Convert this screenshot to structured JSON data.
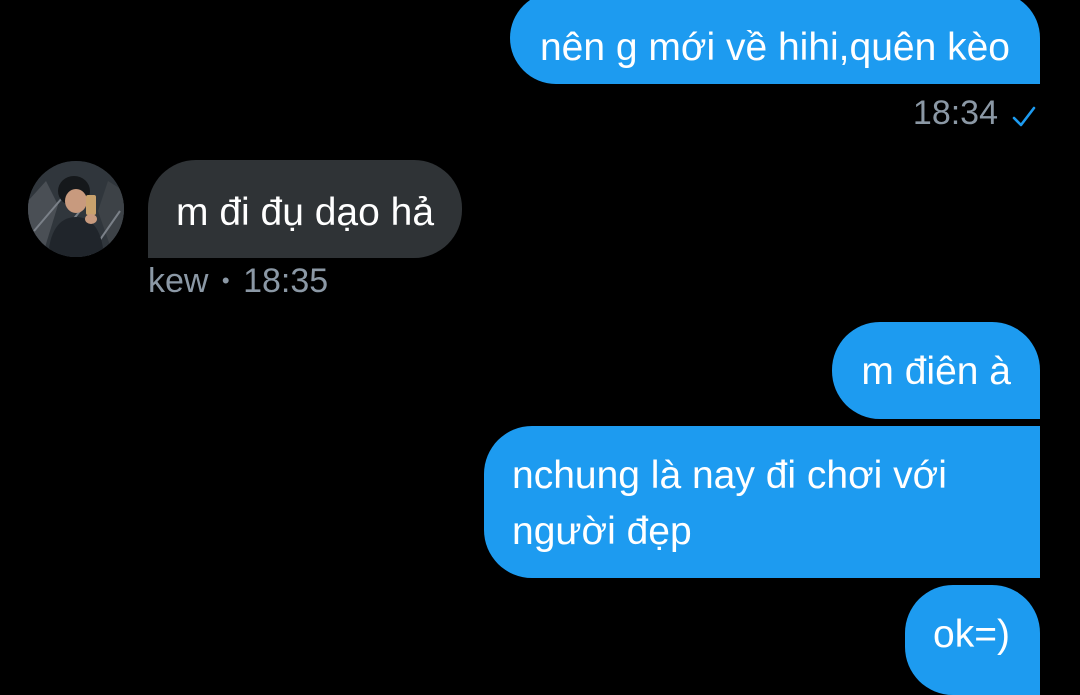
{
  "colors": {
    "background": "#000000",
    "outgoing_bubble": "#1d9bf0",
    "incoming_bubble": "#2f3336",
    "meta_text": "#8b98a5",
    "read_check": "#1d9bf0"
  },
  "messages": [
    {
      "direction": "outgoing",
      "text": "nên g mới về hihi,quên kèo"
    },
    {
      "direction": "outgoing",
      "timestamp": "18:34",
      "status_icon": "read-check-icon"
    },
    {
      "direction": "incoming",
      "sender": "kew",
      "separator": "•",
      "text": "m đi đụ dạo hả",
      "timestamp": "18:35",
      "avatar_icon": "user-avatar"
    },
    {
      "direction": "outgoing",
      "text": "m điên à"
    },
    {
      "direction": "outgoing",
      "lines": [
        "nchung là nay đi chơi với",
        "người đẹp"
      ]
    },
    {
      "direction": "outgoing",
      "text": "ok=)"
    }
  ]
}
